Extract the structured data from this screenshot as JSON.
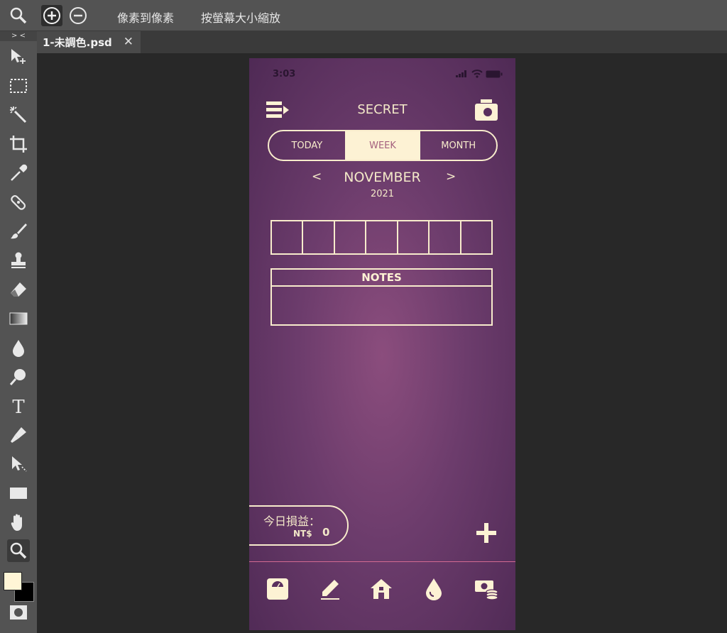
{
  "options_bar": {
    "zoom_icon": "zoom-icon",
    "zoom_in_icon": "zoom-in-icon",
    "zoom_out_icon": "zoom-out-icon",
    "actual_pixels": "像素到像素",
    "fit_screen": "按螢幕大小縮放"
  },
  "tabs": [
    {
      "label": "1-未調色.psd",
      "close": "✕"
    }
  ],
  "toolbar": {
    "collapse": "> <",
    "tools": [
      "move-tool-icon",
      "marquee-tool-icon",
      "magic-wand-icon",
      "crop-tool-icon",
      "eyedropper-icon",
      "healing-brush-icon",
      "brush-tool-icon",
      "stamp-tool-icon",
      "eraser-tool-icon",
      "gradient-tool-icon",
      "blur-tool-icon",
      "dodge-tool-icon",
      "type-tool-icon",
      "pen-tool-icon",
      "path-select-icon",
      "rectangle-tool-icon",
      "hand-tool-icon",
      "zoom-tool-icon"
    ],
    "foreground_color": "#fff5d6",
    "background_color": "#000000"
  },
  "phone": {
    "status_time": "3:03",
    "title": "SECRET",
    "segments": [
      "TODAY",
      "WEEK",
      "MONTH"
    ],
    "active_segment": "WEEK",
    "month_prev": "<",
    "month": "NOVEMBER",
    "month_next": ">",
    "year": "2021",
    "notes_title": "NOTES",
    "pnl_label": "今日損益：",
    "pnl_currency": "NT$",
    "pnl_value": "0",
    "nav": [
      "scale-icon",
      "pencil-icon",
      "home-icon",
      "drop-icon",
      "money-icon"
    ],
    "accent": "#fdf2d4",
    "divider_color": "#d36a92"
  }
}
